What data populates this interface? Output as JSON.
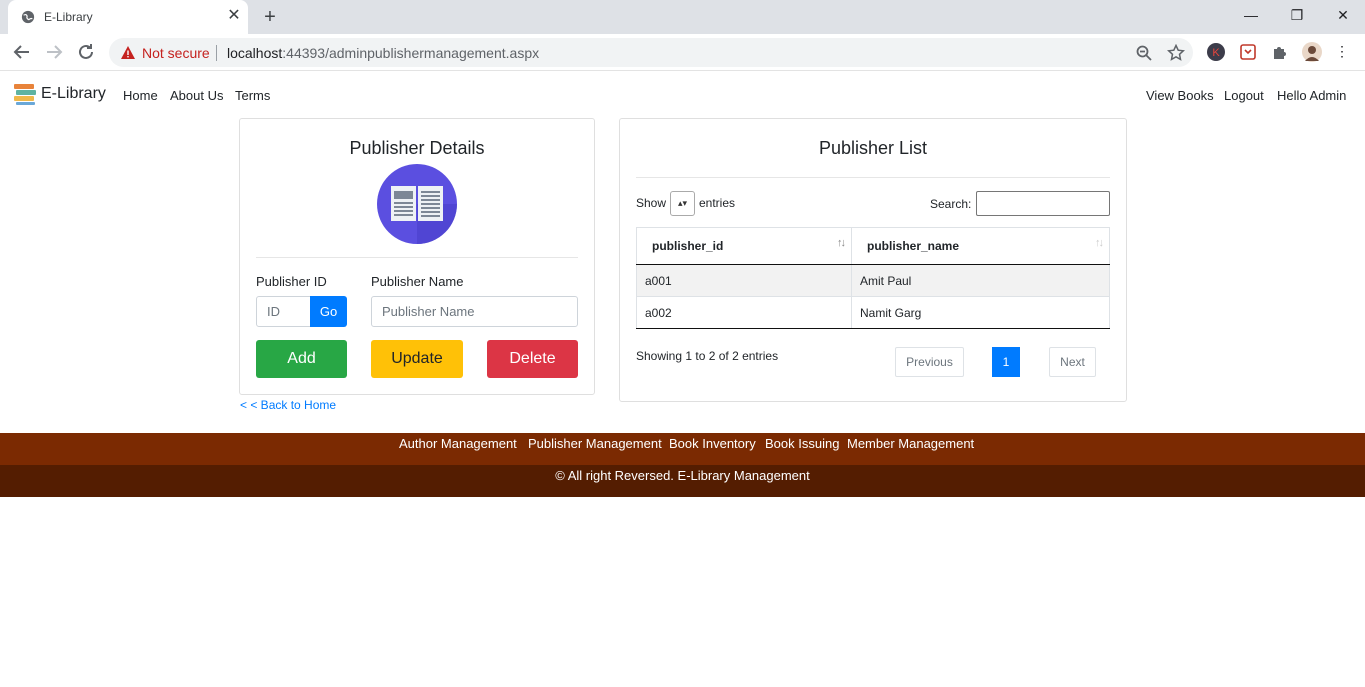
{
  "browser": {
    "tab_title": "E-Library",
    "security_label": "Not secure",
    "url_host": "localhost",
    "url_path": ":44393/adminpublishermanagement.aspx",
    "profile_initial": "K"
  },
  "navbar": {
    "brand": "E-Library",
    "left_links": [
      "Home",
      "About Us",
      "Terms"
    ],
    "right_links": [
      "View Books",
      "Logout",
      "Hello Admin"
    ]
  },
  "publisher_details": {
    "title": "Publisher Details",
    "id_label": "Publisher ID",
    "id_placeholder": "ID",
    "go_label": "Go",
    "name_label": "Publisher Name",
    "name_placeholder": "Publisher Name",
    "add_label": "Add",
    "update_label": "Update",
    "delete_label": "Delete"
  },
  "back_link": "< < Back to Home",
  "publisher_list": {
    "title": "Publisher List",
    "show_label": "Show",
    "entries_label": "entries",
    "search_label": "Search:",
    "columns": [
      "publisher_id",
      "publisher_name"
    ],
    "rows": [
      [
        "a001",
        "Amit Paul"
      ],
      [
        "a002",
        "Namit Garg"
      ]
    ],
    "info": "Showing 1 to 2 of 2 entries",
    "previous_label": "Previous",
    "current_page": "1",
    "next_label": "Next"
  },
  "footer": {
    "links": [
      "Author Management",
      "Publisher Management",
      "Book Inventory",
      "Book Issuing",
      "Member Management"
    ],
    "copyright": "© All right Reversed. E-Library Management"
  },
  "colors": {
    "primary": "#007bff",
    "add": "#28a745",
    "update": "#ffc107",
    "delete": "#dc3545",
    "footer_top": "#7b2a02",
    "footer_bottom": "#541d01"
  }
}
